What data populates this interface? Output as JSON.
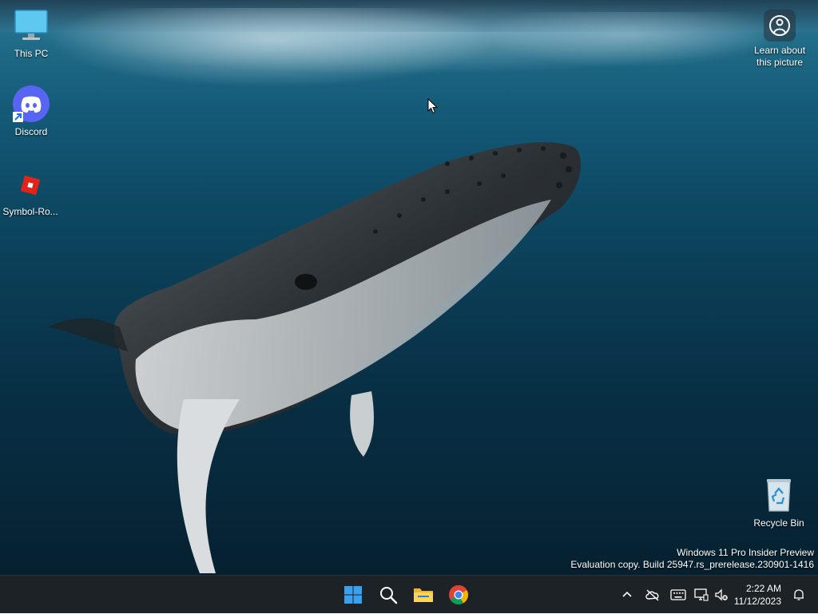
{
  "desktop": {
    "icons": [
      {
        "label": "This PC",
        "icon": "monitor-icon"
      },
      {
        "label": "Discord",
        "icon": "discord-icon"
      },
      {
        "label": "Symbol-Ro...",
        "icon": "roblox-icon"
      },
      {
        "label": "Recycle Bin",
        "icon": "recycle-bin-icon"
      }
    ],
    "learn_picture": {
      "line1": "Learn about",
      "line2": "this picture",
      "icon": "camera-globe-icon"
    },
    "watermark": {
      "line1": "Windows 11 Pro Insider Preview",
      "line2": "Evaluation copy. Build 25947.rs_prerelease.230901-1416"
    }
  },
  "taskbar": {
    "apps": [
      {
        "name": "Start",
        "icon": "windows-start-icon"
      },
      {
        "name": "Search",
        "icon": "search-icon"
      },
      {
        "name": "File Explorer",
        "icon": "folder-icon"
      },
      {
        "name": "Google Chrome",
        "icon": "chrome-icon"
      }
    ],
    "tray": [
      "chevron-up-icon",
      "cloud-off-icon",
      "keyboard-icon",
      "network-icon",
      "volume-muted-icon"
    ],
    "clock": {
      "time": "2:22 AM",
      "date": "11/12/2023"
    },
    "notification_icon": "bell-icon"
  },
  "colors": {
    "taskbar_bg": "#1c2226",
    "discord": "#5865f2",
    "roblox": "#e2231a",
    "chrome_red": "#db4437",
    "chrome_yellow": "#f4b400",
    "chrome_green": "#0f9d58",
    "chrome_blue": "#4285f4",
    "start_blue": "#3aa0f0"
  }
}
